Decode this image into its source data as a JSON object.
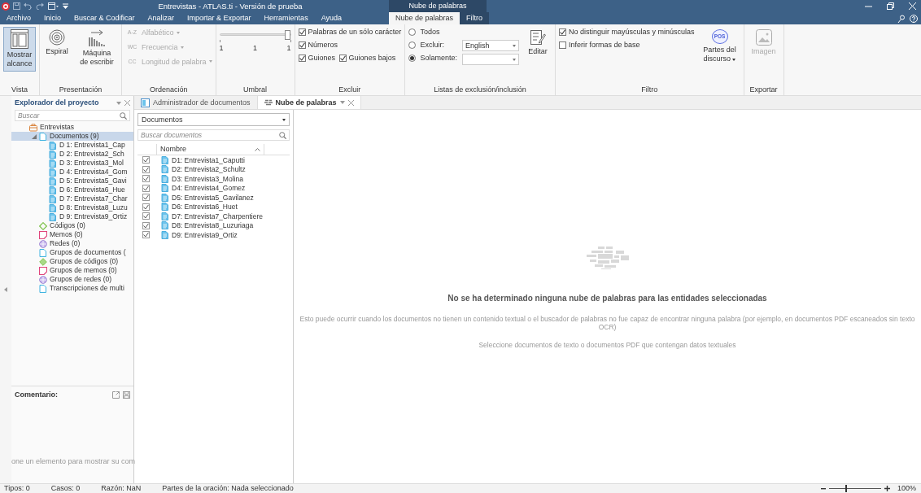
{
  "title_bar": {
    "title": "Entrevistas - ATLAS.ti - Versión de prueba",
    "context_label": "Nube de palabras"
  },
  "tabs": [
    {
      "label": "Archivo",
      "selected": false,
      "contextual": false
    },
    {
      "label": "Inicio",
      "selected": false,
      "contextual": false
    },
    {
      "label": "Buscar & Codificar",
      "selected": false,
      "contextual": false
    },
    {
      "label": "Analizar",
      "selected": false,
      "contextual": false
    },
    {
      "label": "Importar & Exportar",
      "selected": false,
      "contextual": false
    },
    {
      "label": "Herramientas",
      "selected": false,
      "contextual": false
    },
    {
      "label": "Ayuda",
      "selected": false,
      "contextual": false
    },
    {
      "label": "Nube de palabras",
      "selected": true,
      "contextual": true
    },
    {
      "label": "Filtro",
      "selected": false,
      "contextual": true
    }
  ],
  "ribbon": [
    {
      "label": "Vista",
      "columns": [
        [
          {
            "kind": "scope",
            "label": "Mostrar alcance",
            "selected": true,
            "disabled": false
          }
        ]
      ]
    },
    {
      "label": "Presentación",
      "columns": [
        [
          {
            "kind": "spiral",
            "label": "Espiral",
            "selected": false,
            "disabled": false
          }
        ],
        [
          {
            "kind": "typewriter",
            "label": "Máquina de escribir",
            "selected": false,
            "disabled": false
          }
        ]
      ]
    },
    {
      "label": "Ordenación",
      "columns": [
        [
          {
            "kind": "sort_option",
            "prefix": "A-Z",
            "label": "Alfabético",
            "disabled": true
          },
          {
            "kind": "sort_option",
            "prefix": "WC",
            "label": "Frecuencia",
            "disabled": true
          },
          {
            "kind": "sort_option",
            "prefix": "CC",
            "label": "Longitud de palabra",
            "disabled": true
          }
        ]
      ]
    },
    {
      "label": "Umbral",
      "columns": [
        [
          {
            "kind": "slider",
            "level": 1,
            "ticks": [
              "1",
              "1",
              "1"
            ]
          }
        ]
      ]
    },
    {
      "label": "Excluir",
      "columns": [
        [
          {
            "kind": "checkbox",
            "label": "Palabras de un sólo carácter",
            "checked": true
          },
          {
            "kind": "checkbox",
            "label": "Números",
            "checked": true
          },
          {
            "kind": "row",
            "items": [
              {
                "kind": "checkbox",
                "label": "Guiones",
                "checked": true
              },
              {
                "kind": "checkbox",
                "label": "Guiones bajos",
                "checked": true
              }
            ]
          }
        ]
      ]
    },
    {
      "label": "Listas de exclusión/inclusión",
      "columns": [
        [
          {
            "kind": "radio",
            "label": "Todos",
            "selected": false
          },
          {
            "kind": "radio",
            "label": "Excluir:",
            "selected": false
          },
          {
            "kind": "radio",
            "label": "Solamente:",
            "selected": true
          }
        ],
        [
          {
            "kind": "dropdown",
            "value": "English"
          },
          {
            "kind": "dropdown"
          }
        ],
        [
          {
            "kind": "edit_list",
            "label": "Editar",
            "selected": false,
            "disabled": false
          }
        ]
      ]
    },
    {
      "label": "Filtro",
      "columns": [
        [
          {
            "kind": "checkbox",
            "label": "No distinguir mayúsculas y minúsculas",
            "checked": true
          },
          {
            "kind": "checkbox",
            "label": "Inferir formas de base",
            "checked": false
          }
        ],
        [
          {
            "kind": "pos",
            "badge": "POS",
            "label": "Partes del discurso",
            "selected": false,
            "disabled": false
          }
        ]
      ]
    },
    {
      "label": "Exportar",
      "columns": [
        [
          {
            "kind": "image",
            "label": "Imagen",
            "selected": false,
            "disabled": true
          }
        ]
      ]
    }
  ],
  "explorer": {
    "title": "Explorador del proyecto",
    "search_placeholder": "Buscar",
    "tree": [
      {
        "kind": "project",
        "label": "Entrevistas",
        "selected": false,
        "children": [
          {
            "kind": "document_group",
            "label": "Documentos (9)",
            "selected": true,
            "expanded": true,
            "children": [
              {
                "kind": "document",
                "label": "D 1: Entrevista1_Cap",
                "selected": false
              },
              {
                "kind": "document",
                "label": "D 2: Entrevista2_Sch",
                "selected": false
              },
              {
                "kind": "document",
                "label": "D 3: Entrevista3_Mol",
                "selected": false
              },
              {
                "kind": "document",
                "label": "D 4: Entrevista4_Gom",
                "selected": false
              },
              {
                "kind": "document",
                "label": "D 5: Entrevista5_Gavi",
                "selected": false
              },
              {
                "kind": "document",
                "label": "D 6: Entrevista6_Hue",
                "selected": false
              },
              {
                "kind": "document",
                "label": "D 7: Entrevista7_Char",
                "selected": false
              },
              {
                "kind": "document",
                "label": "D 8: Entrevista8_Luzu",
                "selected": false
              },
              {
                "kind": "document",
                "label": "D 9: Entrevista9_Ortiz",
                "selected": false
              }
            ]
          },
          {
            "kind": "code",
            "label": "Códigos (0)",
            "selected": false
          },
          {
            "kind": "memo",
            "label": "Memos (0)",
            "selected": false
          },
          {
            "kind": "network",
            "label": "Redes (0)",
            "selected": false
          },
          {
            "kind": "document_group",
            "label": "Grupos de documentos (",
            "selected": false
          },
          {
            "kind": "code_group",
            "label": "Grupos de códigos (0)",
            "selected": false
          },
          {
            "kind": "memo",
            "label": "Grupos de memos (0)",
            "selected": false
          },
          {
            "kind": "network",
            "label": "Grupos de redes (0)",
            "selected": false
          },
          {
            "kind": "document_group",
            "label": "Transcripciones de multi",
            "selected": false
          }
        ]
      }
    ]
  },
  "comment": {
    "title": "Comentario:",
    "text": "one un elemento para mostrar su com"
  },
  "doc_tabs": [
    {
      "label": "Administrador de documentos",
      "selected": false,
      "closable": false
    },
    {
      "label": "Nube de palabras",
      "selected": true,
      "closable": true
    }
  ],
  "documents_panel": {
    "selector": "Documentos",
    "search_placeholder": "Buscar documentos",
    "column": "Nombre",
    "rows": [
      {
        "label": "D1: Entrevista1_Caputti",
        "checked": true
      },
      {
        "label": "D2: Entrevista2_Schultz",
        "checked": true
      },
      {
        "label": "D3: Entrevista3_Molina",
        "checked": true
      },
      {
        "label": "D4: Entrevista4_Gomez",
        "checked": true
      },
      {
        "label": "D5: Entrevista5_Gavilanez",
        "checked": true
      },
      {
        "label": "D6: Entrevista6_Huet",
        "checked": true
      },
      {
        "label": "D7: Entrevista7_Charpentiere",
        "checked": true
      },
      {
        "label": "D8: Entrevista8_Luzuriaga",
        "checked": true
      },
      {
        "label": "D9: Entrevista9_Ortiz",
        "checked": true
      }
    ]
  },
  "cloud": {
    "heading": "No se ha determinado ninguna nube de palabras para las entidades seleccionadas",
    "message": "Esto puede ocurrir cuando los documentos no tienen un contenido textual o el buscador de palabras no fue capaz de encontrar ninguna palabra (por ejemplo, en documentos PDF escaneados sin texto OCR)",
    "hint": "Seleccione documentos de texto o documentos PDF que contengan datos textuales"
  },
  "status_bar": {
    "items": [
      "Tipos: 0",
      "Casos: 0",
      "Razón: NaN",
      "Partes de la oración: Nada seleccionado"
    ],
    "zoom": {
      "level": 0.3,
      "label": "100%"
    }
  }
}
